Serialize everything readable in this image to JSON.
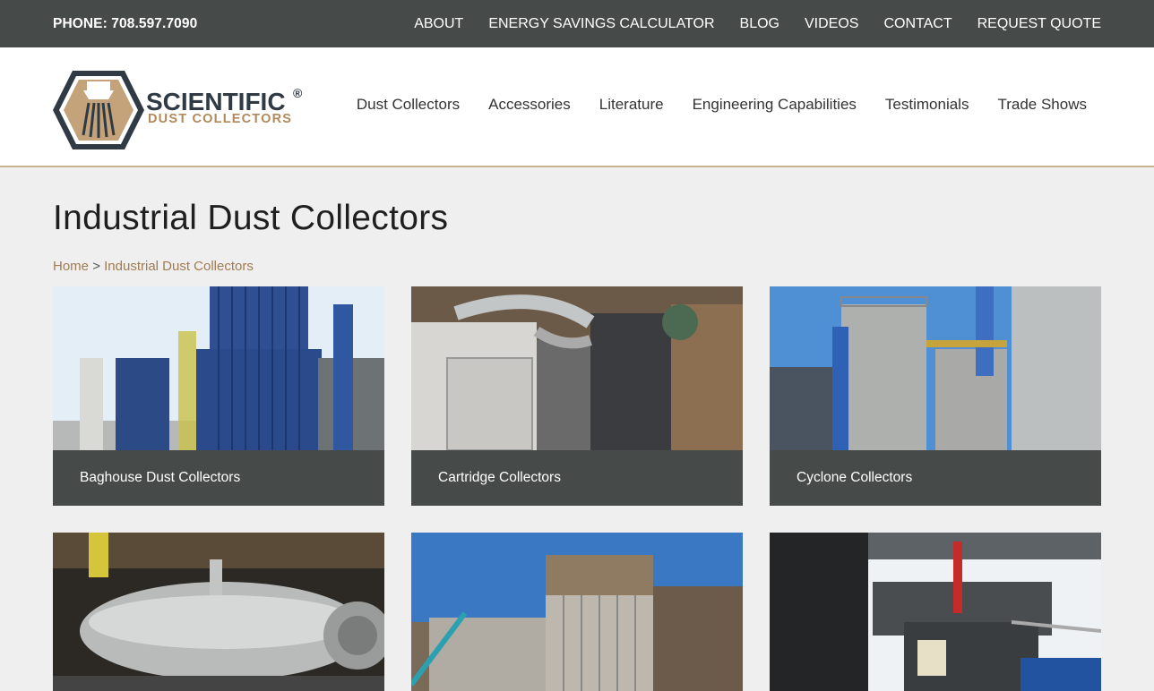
{
  "topbar": {
    "phone": "PHONE: 708.597.7090",
    "links": [
      "ABOUT",
      "ENERGY SAVINGS CALCULATOR",
      "BLOG",
      "VIDEOS",
      "CONTACT",
      "REQUEST QUOTE"
    ]
  },
  "logo": {
    "line1": "SCIENTIFIC",
    "line2": "DUST COLLECTORS",
    "registered": "®"
  },
  "mainnav": [
    "Dust Collectors",
    "Accessories",
    "Literature",
    "Engineering Capabilities",
    "Testimonials",
    "Trade Shows"
  ],
  "page": {
    "title": "Industrial Dust Collectors"
  },
  "breadcrumb": {
    "home": "Home",
    "separator": ">",
    "current": "Industrial Dust Collectors"
  },
  "cards": [
    {
      "label": "Baghouse Dust Collectors"
    },
    {
      "label": "Cartridge Collectors"
    },
    {
      "label": "Cyclone Collectors"
    }
  ],
  "colors": {
    "topbar": "#464a48",
    "accent": "#a07c52",
    "card_label_bg": "#464a48"
  }
}
